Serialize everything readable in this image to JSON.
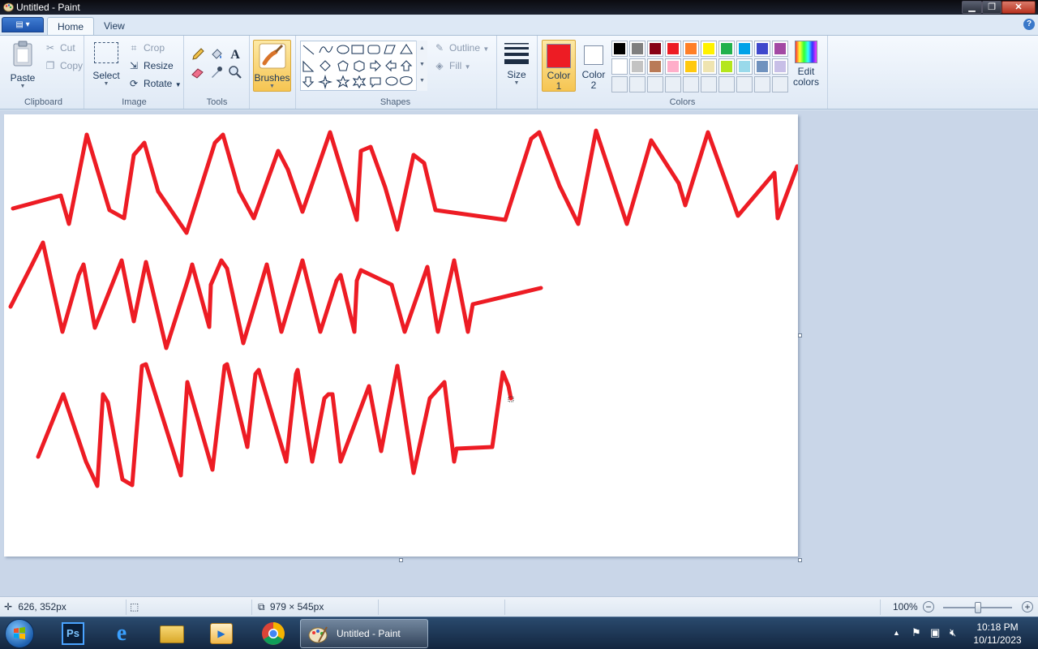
{
  "window": {
    "title": "Untitled - Paint"
  },
  "tabs": [
    {
      "label": "Home",
      "active": true
    },
    {
      "label": "View",
      "active": false
    }
  ],
  "ribbon": {
    "clipboard": {
      "label": "Clipboard",
      "paste": "Paste",
      "cut": "Cut",
      "copy": "Copy"
    },
    "image": {
      "label": "Image",
      "select": "Select",
      "crop": "Crop",
      "resize": "Resize",
      "rotate": "Rotate"
    },
    "tools": {
      "label": "Tools",
      "items": [
        "pencil-icon",
        "fill-icon",
        "text-icon",
        "eraser-icon",
        "color-picker-icon",
        "magnifier-icon"
      ]
    },
    "brushes": {
      "label": "Brushes"
    },
    "shapes": {
      "label": "Shapes",
      "outline": "Outline",
      "fill": "Fill"
    },
    "size": {
      "label": "Size"
    },
    "colors": {
      "label": "Colors",
      "color1": "Color 1",
      "color2": "Color 2",
      "color1_value": "#ed1c24",
      "color2_value": "#ffffff",
      "edit": "Edit colors",
      "palette_row1": [
        "#000000",
        "#7f7f7f",
        "#880015",
        "#ed1c24",
        "#ff7f27",
        "#fff200",
        "#22b14c",
        "#00a2e8",
        "#3f48cc",
        "#a349a4"
      ],
      "palette_row2": [
        "#ffffff",
        "#c3c3c3",
        "#b97a57",
        "#ffaec9",
        "#ffc90e",
        "#efe4b0",
        "#b5e61d",
        "#99d9ea",
        "#7092be",
        "#c8bfe7"
      ]
    }
  },
  "canvas": {
    "stroke_color": "#ed1c24"
  },
  "status": {
    "cursor_pos": "626, 352px",
    "canvas_size": "979 × 545px",
    "zoom": "100%"
  },
  "taskbar": {
    "active_window": "Untitled - Paint",
    "time": "10:18 PM",
    "date": "10/11/2023"
  }
}
